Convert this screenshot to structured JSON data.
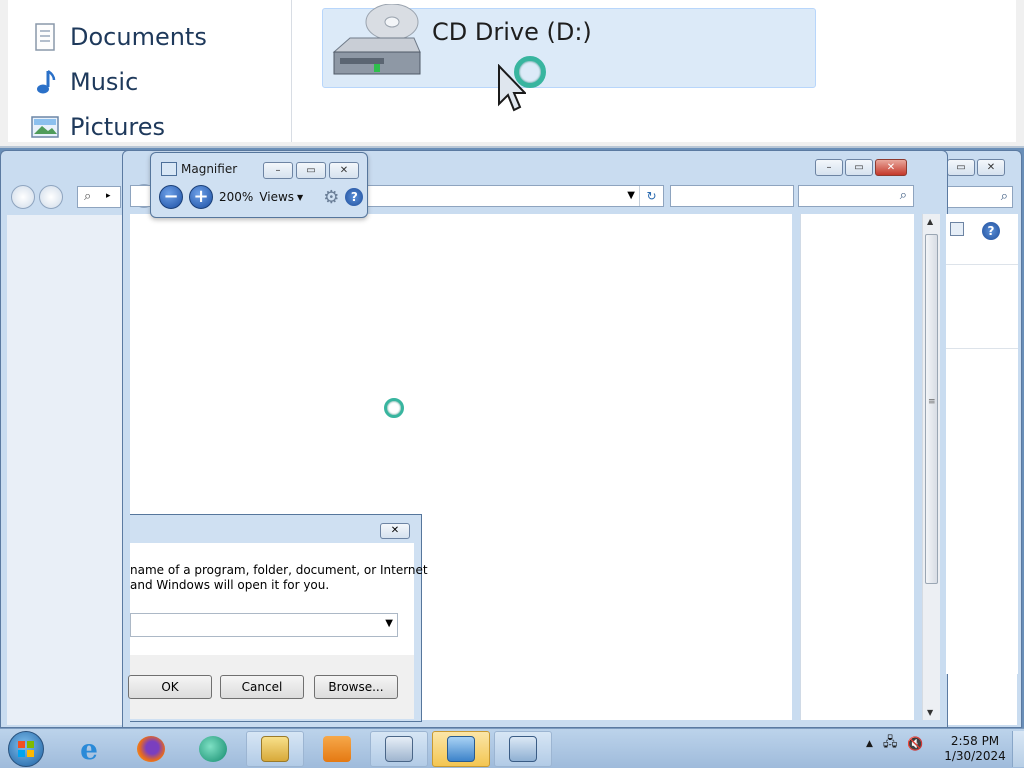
{
  "lens": {
    "nav_items": [
      "Documents",
      "Music",
      "Pictures"
    ],
    "selected_drive": "CD Drive (D:)"
  },
  "magnifier": {
    "title": "Magnifier",
    "zoom_percent": "200%",
    "views_label": "Views"
  },
  "run_dialog": {
    "description_line1": "name of a program, folder, document, or Internet",
    "description_line2": "and Windows will open it for you.",
    "open_value": "",
    "ok_label": "OK",
    "cancel_label": "Cancel",
    "browse_label": "Browse..."
  },
  "taskbar": {
    "items": [
      "internet-explorer",
      "firefox",
      "app-green",
      "windows-explorer",
      "media-player",
      "remote-desktop",
      "control-panel",
      "magnifier"
    ],
    "clock_time": "2:58 PM",
    "clock_date": "1/30/2024"
  },
  "colors": {
    "accent": "#38b59f",
    "window_frame": "#c9dcf0",
    "close_button": "#c4382a",
    "taskbar": "#bcd3eb"
  }
}
